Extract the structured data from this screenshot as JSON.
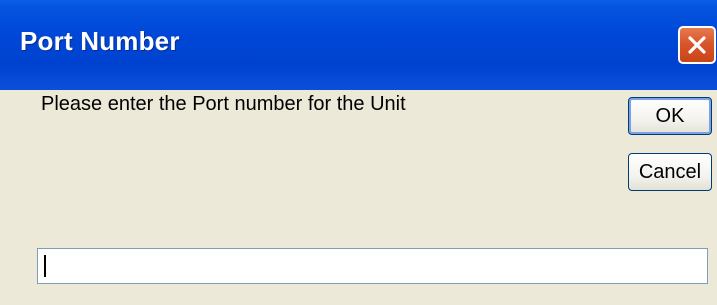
{
  "window": {
    "title": "Port Number",
    "close_icon": "close-icon"
  },
  "dialog": {
    "prompt": "Please enter the Port number for the Unit",
    "ok_label": "OK",
    "cancel_label": "Cancel",
    "input_value": ""
  },
  "colors": {
    "titlebar": "#0048d8",
    "close_button": "#d9562c",
    "background": "#ece9d8"
  }
}
